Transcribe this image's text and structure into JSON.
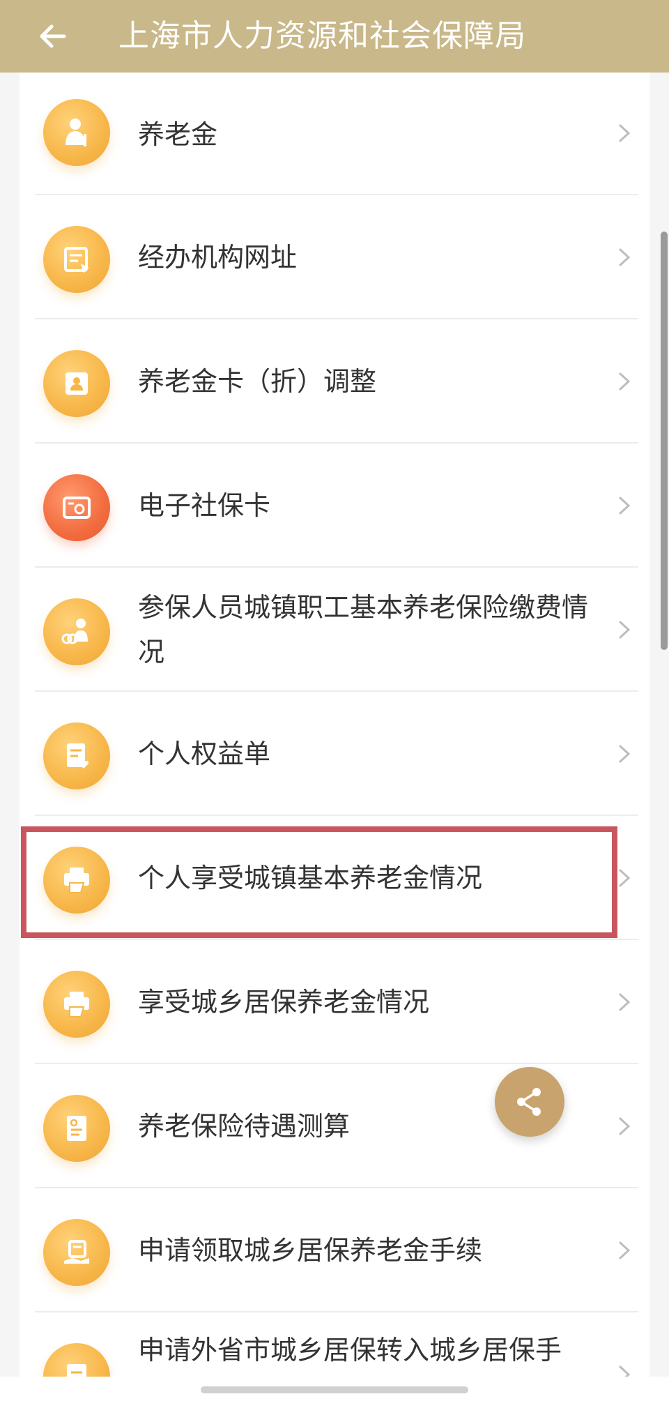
{
  "header": {
    "title": "上海市人力资源和社会保障局",
    "back_icon": "arrow-left-icon",
    "background": "#c9b88a"
  },
  "list": {
    "items": [
      {
        "label": "养老金",
        "icon": "elderly-person-icon"
      },
      {
        "label": "经办机构网址",
        "icon": "browser-cursor-icon"
      },
      {
        "label": "养老金卡（折）调整",
        "icon": "person-card-icon"
      },
      {
        "label": "电子社保卡",
        "icon": "social-security-card-icon"
      },
      {
        "label": "参保人员城镇职工基本养老保险缴费情况",
        "icon": "worker-coins-icon"
      },
      {
        "label": "个人权益单",
        "icon": "document-heart-icon"
      },
      {
        "label": "个人享受城镇基本养老金情况",
        "icon": "printer-icon"
      },
      {
        "label": "享受城乡居保养老金情况",
        "icon": "printer-icon"
      },
      {
        "label": "养老保险待遇测算",
        "icon": "calculator-doc-icon"
      },
      {
        "label": "申请领取城乡居保养老金手续",
        "icon": "hand-document-icon"
      },
      {
        "label": "申请外省市城乡居保转入城乡居保手",
        "icon": "transfer-doc-icon"
      }
    ]
  },
  "highlight_color": "#c9565e",
  "share_icon": "share-icon",
  "accent": "#f7b648"
}
